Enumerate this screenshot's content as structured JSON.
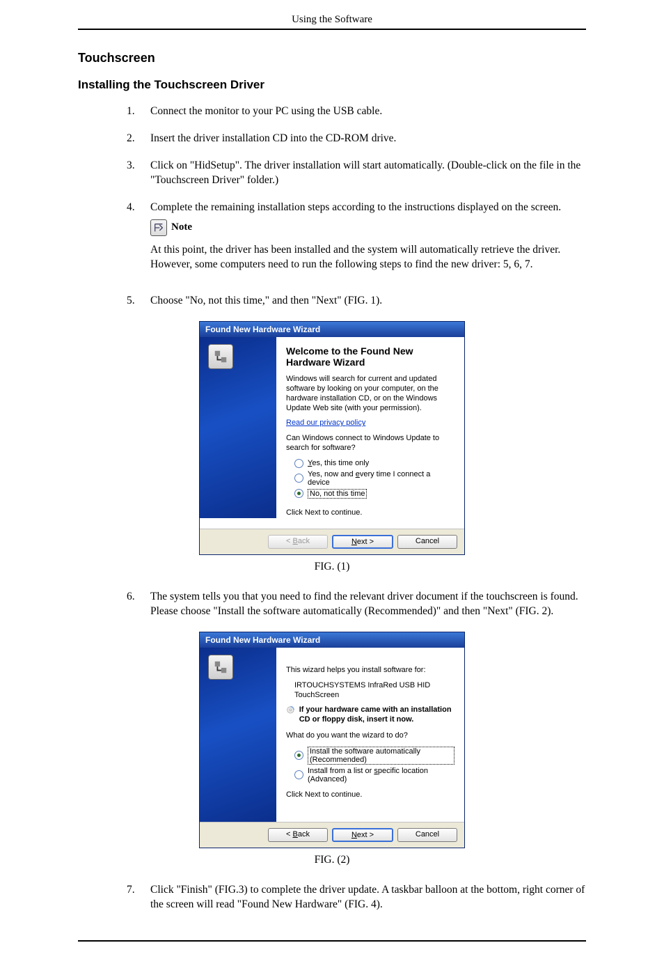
{
  "header": {
    "running": "Using the Software"
  },
  "section": {
    "h2": "Touchscreen",
    "h3": "Installing the Touchscreen Driver"
  },
  "steps": {
    "s1": "Connect the monitor to your PC using the USB cable.",
    "s2": "Insert the driver installation CD into the CD-ROM drive.",
    "s3": "Click on \"HidSetup\". The driver installation will start automatically. (Double-click on the file in the \"Touchscreen Driver\" folder.)",
    "s4_line1": "Complete the remaining installation steps according to the instructions displayed on the screen.",
    "s4_note_label": "Note",
    "s4_note_body": "At this point, the driver has been installed and the system will automatically retrieve the driver. However, some computers need to run the following steps to find the new driver: 5, 6, 7.",
    "s5": "Choose \"No, not this time,\" and then \"Next\" (FIG. 1).",
    "s6": "The system tells you that you need to find the relevant driver document if the touchscreen is found. Please choose \"Install the software automatically (Recommended)\" and then \"Next\" (FIG. 2).",
    "s7": "Click \"Finish\" (FIG.3) to complete the driver update. A taskbar balloon at the bottom, right corner of the screen will read \"Found New Hardware\" (FIG. 4)."
  },
  "fig1": {
    "caption": "FIG. (1)",
    "title": "Found New Hardware Wizard",
    "heading": "Welcome to the Found New Hardware Wizard",
    "p1": "Windows will search for current and updated software by looking on your computer, on the hardware installation CD, or on the Windows Update Web site (with your permission).",
    "privacy": "Read our privacy policy",
    "p2": "Can Windows connect to Windows Update to search for software?",
    "opt1": "Yes, this time only",
    "opt2": "Yes, now and every time I connect a device",
    "opt3": "No, not this time",
    "continue": "Click Next to continue.",
    "btn_back": "< Back",
    "btn_next": "Next >",
    "btn_cancel": "Cancel"
  },
  "fig2": {
    "caption": "FIG. (2)",
    "title": "Found New Hardware Wizard",
    "p1": "This wizard helps you install software for:",
    "device": "IRTOUCHSYSTEMS InfraRed USB HID TouchScreen",
    "cd_text": "If your hardware came with an installation CD or floppy disk, insert it now.",
    "q": "What do you want the wizard to do?",
    "opt1": "Install the software automatically (Recommended)",
    "opt2": "Install from a list or specific location (Advanced)",
    "continue": "Click Next to continue.",
    "btn_back": "< Back",
    "btn_next": "Next >",
    "btn_cancel": "Cancel"
  }
}
